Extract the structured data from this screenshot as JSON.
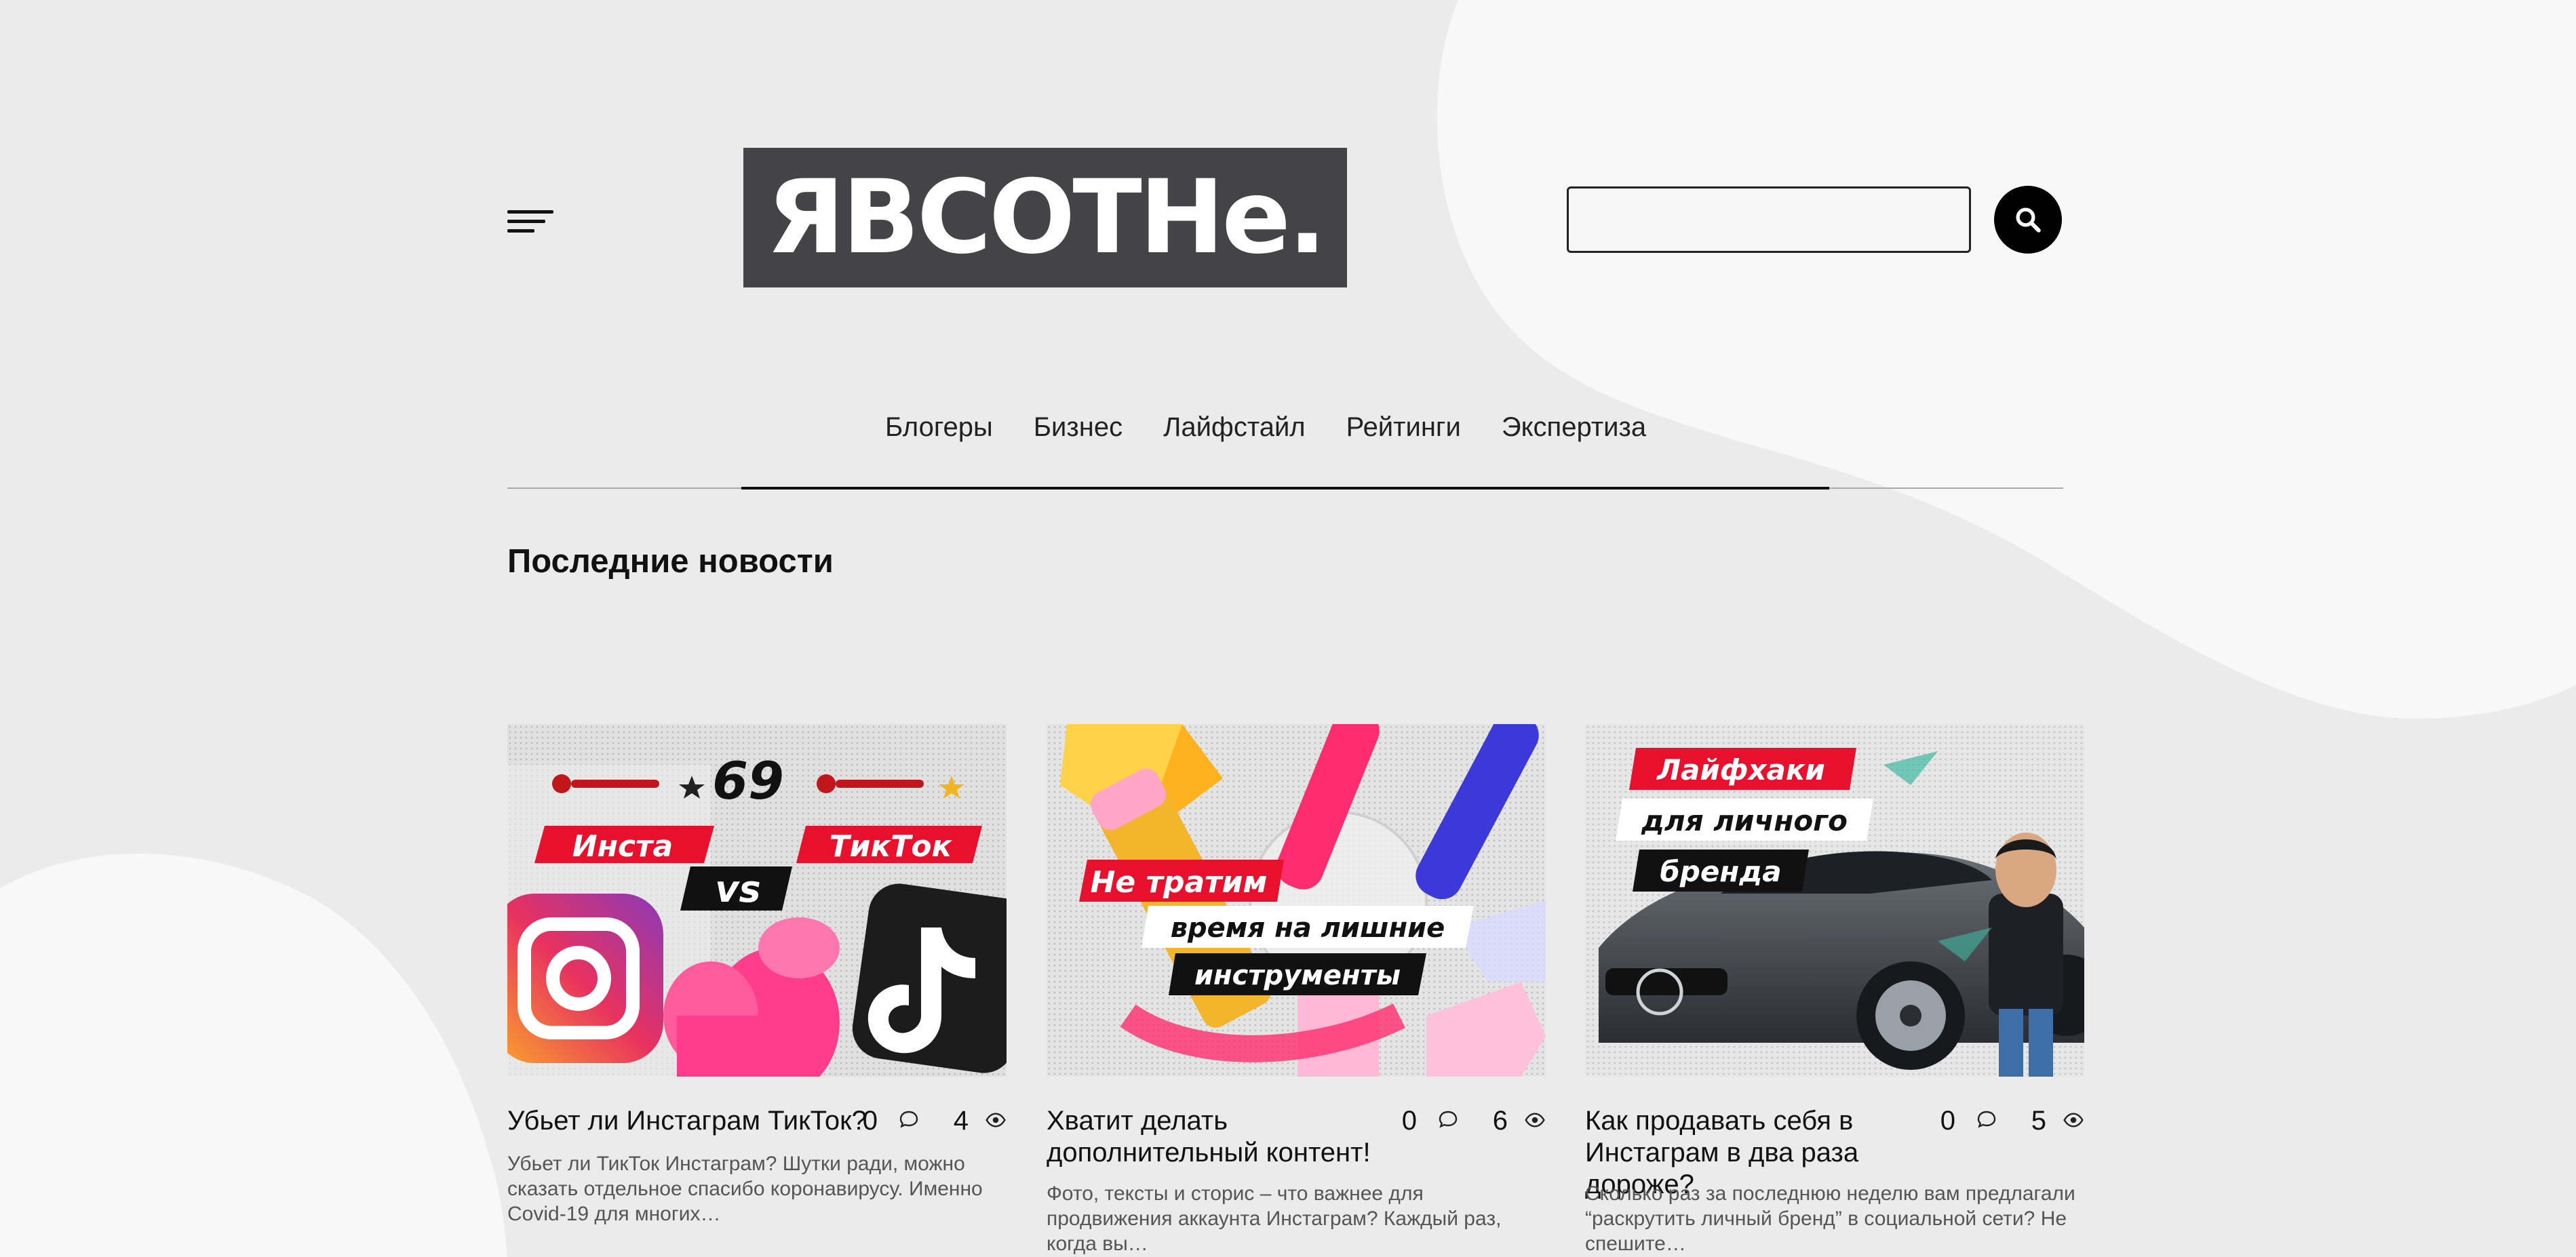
{
  "site": {
    "logo_text": "ЯВСОТНе.",
    "search_placeholder": ""
  },
  "nav": {
    "items": [
      {
        "label": "Блогеры"
      },
      {
        "label": "Бизнес"
      },
      {
        "label": "Лайфстайл"
      },
      {
        "label": "Рейтинги"
      },
      {
        "label": "Экспертиза"
      }
    ]
  },
  "section": {
    "title": "Последние новости"
  },
  "cards": [
    {
      "title": "Убьет ли Инстаграм ТикТок?",
      "comments": "0",
      "views": "4",
      "excerpt": "Убьет ли ТикТок Инстаграм? Шутки ради, можно сказать отдельное спасибо коронавирусу. Именно Covid-19 для многих…",
      "banner": {
        "line1": "Инста",
        "line2": "vs",
        "line3": "ТикТок",
        "counter": "69"
      }
    },
    {
      "title": "Хватит делать дополнительный контент!",
      "comments": "0",
      "views": "6",
      "excerpt": "Фото, тексты и сторис – что важнее для продвижения аккаунта Инстаграм? Каждый раз, когда вы…",
      "banner": {
        "line1": "Не тратим",
        "line2": "время на лишние",
        "line3": "инструменты"
      }
    },
    {
      "title": "Как продавать себя в Инстаграм в два раза дороже?",
      "comments": "0",
      "views": "5",
      "excerpt": "Сколько раз за последнюю неделю вам предлагали “раскрутить личный бренд” в социальной сети? Не спешите…",
      "banner": {
        "line1": "Лайфхаки",
        "line2": "для личного",
        "line3": "бренда"
      }
    }
  ],
  "colors": {
    "background": "#ebebeb",
    "blob": "#f8f8f8",
    "logo_bg": "#444446",
    "accent_red": "#e8112d",
    "pink": "#ff3d8b"
  },
  "icons": [
    "menu-icon",
    "search-icon",
    "comment-icon",
    "eye-icon"
  ]
}
